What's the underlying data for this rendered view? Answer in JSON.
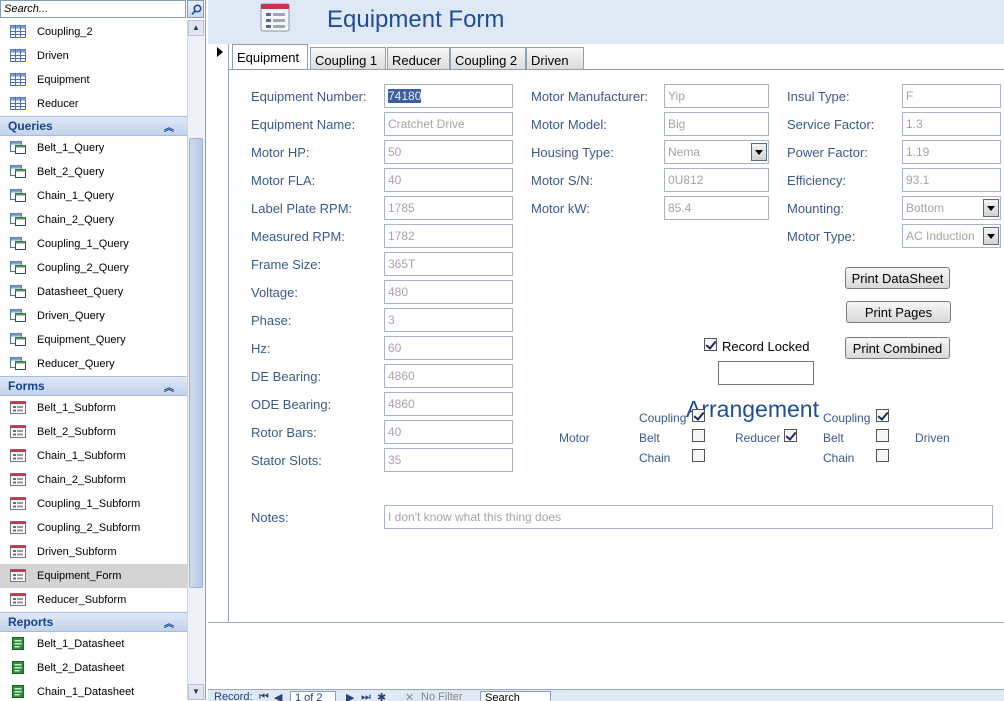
{
  "nav_pane": {
    "search_placeholder": "Search...",
    "top_items": [
      {
        "label": "Coupling_2",
        "icon": "table-icon"
      },
      {
        "label": "Driven",
        "icon": "table-icon"
      },
      {
        "label": "Equipment",
        "icon": "table-icon"
      },
      {
        "label": "Reducer",
        "icon": "table-icon"
      }
    ],
    "groups": [
      {
        "title": "Queries",
        "icon": "query-icon",
        "items": [
          "Belt_1_Query",
          "Belt_2_Query",
          "Chain_1_Query",
          "Chain_2_Query",
          "Coupling_1_Query",
          "Coupling_2_Query",
          "Datasheet_Query",
          "Driven_Query",
          "Equipment_Query",
          "Reducer_Query"
        ]
      },
      {
        "title": "Forms",
        "icon": "form-icon",
        "items": [
          "Belt_1_Subform",
          "Belt_2_Subform",
          "Chain_1_Subform",
          "Chain_2_Subform",
          "Coupling_1_Subform",
          "Coupling_2_Subform",
          "Driven_Subform",
          "Equipment_Form",
          "Reducer_Subform"
        ],
        "selected": "Equipment_Form"
      },
      {
        "title": "Reports",
        "icon": "report-icon",
        "items": [
          "Belt_1_Datasheet",
          "Belt_2_Datasheet",
          "Chain_1_Datasheet"
        ]
      }
    ]
  },
  "form": {
    "title": "Equipment Form",
    "tabs": [
      "Equipment",
      "Coupling 1",
      "Reducer",
      "Coupling 2",
      "Driven"
    ],
    "active_tab": "Equipment",
    "col1": [
      {
        "label": "Equipment Number:",
        "value": "74180",
        "selected": true
      },
      {
        "label": "Equipment Name:",
        "value": "Cratchet Drive"
      },
      {
        "label": "Motor HP:",
        "value": "50"
      },
      {
        "label": "Motor FLA:",
        "value": "40"
      },
      {
        "label": "Label Plate RPM:",
        "value": "1785"
      },
      {
        "label": "Measured RPM:",
        "value": "1782"
      },
      {
        "label": "Frame Size:",
        "value": "365T"
      },
      {
        "label": "Voltage:",
        "value": "480"
      },
      {
        "label": "Phase:",
        "value": "3"
      },
      {
        "label": "Hz:",
        "value": "60"
      },
      {
        "label": "DE Bearing:",
        "value": "4860"
      },
      {
        "label": "ODE Bearing:",
        "value": "4860"
      },
      {
        "label": "Rotor Bars:",
        "value": "40"
      },
      {
        "label": "Stator Slots:",
        "value": "35"
      }
    ],
    "col2": [
      {
        "label": "Motor Manufacturer:",
        "value": "Yip"
      },
      {
        "label": "Motor Model:",
        "value": "Big"
      },
      {
        "label": "Housing Type:",
        "value": "Nema",
        "combo": true
      },
      {
        "label": "Motor S/N:",
        "value": "0U812"
      },
      {
        "label": "Motor kW:",
        "value": "85.4"
      }
    ],
    "col3": [
      {
        "label": "Insul Type:",
        "value": "F"
      },
      {
        "label": "Service Factor:",
        "value": "1.3"
      },
      {
        "label": "Power Factor:",
        "value": "1.19"
      },
      {
        "label": "Efficiency:",
        "value": "93.1"
      },
      {
        "label": "Mounting:",
        "value": "Bottom",
        "combo": true
      },
      {
        "label": "Motor Type:",
        "value": "AC Induction",
        "combo": true
      }
    ],
    "notes_label": "Notes:",
    "notes_value": "I don't know what this thing does",
    "buttons": {
      "print_datasheet": "Print DataSheet",
      "print_pages": "Print Pages",
      "print_combined": "Print Combined"
    },
    "record_locked": {
      "label": "Record Locked",
      "checked": true
    },
    "arrangement": {
      "title": "Arrangement",
      "motor": "Motor",
      "reducer": "Reducer",
      "driven": "Driven",
      "left_group": [
        {
          "label": "Coupling",
          "checked": true
        },
        {
          "label": "Belt",
          "checked": false
        },
        {
          "label": "Chain",
          "checked": false
        }
      ],
      "reducer_checked": true,
      "right_group": [
        {
          "label": "Coupling",
          "checked": true
        },
        {
          "label": "Belt",
          "checked": false
        },
        {
          "label": "Chain",
          "checked": false
        }
      ]
    }
  },
  "record_nav": {
    "record_label": "Record:",
    "position": "1 of 2",
    "filter": "No Filter",
    "search": "Search"
  }
}
